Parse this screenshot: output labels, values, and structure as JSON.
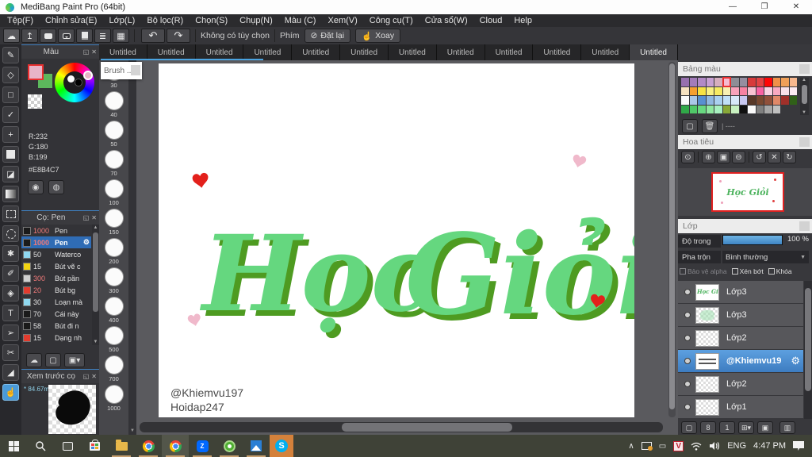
{
  "window": {
    "title": "MediBang Paint Pro (64bit)"
  },
  "menu": {
    "items": [
      "Tệp(F)",
      "Chỉnh sửa(E)",
      "Lớp(L)",
      "Bộ lọc(R)",
      "Chọn(S)",
      "Chụp(N)",
      "Màu (C)",
      "Xem(V)",
      "Công cụ(T)",
      "Cửa sổ(W)",
      "Cloud",
      "Help"
    ]
  },
  "toolbar": {
    "no_option": "Không có tùy chọn",
    "key_label": "Phím",
    "reset_label": "Đặt lại",
    "rotate_label": "Xoay"
  },
  "tabs": {
    "labels": [
      "Untitled",
      "Untitled",
      "Untitled",
      "Untitled",
      "Untitled",
      "Untitled",
      "Untitled",
      "Untitled",
      "Untitled",
      "Untitled",
      "Untitled",
      "Untitled"
    ],
    "active_index": 11
  },
  "tools": [
    {
      "name": "brush-tool-icon",
      "glyph": "✎"
    },
    {
      "name": "eraser-tool-icon",
      "glyph": "◇"
    },
    {
      "name": "rectangle-tool-icon",
      "glyph": "□"
    },
    {
      "name": "snap-tool-icon",
      "glyph": "✓"
    },
    {
      "name": "move-tool-icon",
      "glyph": "+"
    },
    {
      "name": "fill-rect-tool-icon",
      "glyph": "fillsq"
    },
    {
      "name": "bucket-tool-icon",
      "glyph": "◪"
    },
    {
      "name": "gradient-tool-icon",
      "glyph": "grad"
    },
    {
      "name": "select-tool-icon",
      "glyph": "dashbox"
    },
    {
      "name": "lasso-tool-icon",
      "glyph": "dashcirc"
    },
    {
      "name": "magic-wand-tool-icon",
      "glyph": "✱"
    },
    {
      "name": "select-pen-tool-icon",
      "glyph": "✐"
    },
    {
      "name": "select-eraser-tool-icon",
      "glyph": "◈"
    },
    {
      "name": "text-tool-icon",
      "glyph": "T"
    },
    {
      "name": "operation-tool-icon",
      "glyph": "➢"
    },
    {
      "name": "divide-tool-icon",
      "glyph": "✂"
    },
    {
      "name": "eyedropper-tool-icon",
      "glyph": "◢"
    },
    {
      "name": "hand-tool-icon",
      "glyph": "☝",
      "selected": true
    }
  ],
  "color_panel": {
    "title": "Màu",
    "r": "R:232",
    "g": "G:180",
    "b": "B:199",
    "hex": "#E8B4C7",
    "fg_color": "#e8b4c7",
    "bg_color": "#5cb85c"
  },
  "brush_panel": {
    "title": "Cọ: Pen",
    "brushes": [
      {
        "size": "1000",
        "name": "Pen",
        "swatch": "#1a1a1a",
        "red_num": true
      },
      {
        "size": "1000",
        "name": "Pen",
        "swatch": "#1a1a1a",
        "red_num": true,
        "selected": true
      },
      {
        "size": "50",
        "name": "Waterco",
        "swatch": "#8fd8f0"
      },
      {
        "size": "15",
        "name": "Bút vẽ c",
        "swatch": "#f2d411"
      },
      {
        "size": "300",
        "name": "Bút pần",
        "swatch": "#cfcfcf",
        "red_num": true
      },
      {
        "size": "20",
        "name": "Bút bg",
        "swatch": "#e23b2e",
        "red_num": true
      },
      {
        "size": "30",
        "name": "Loạn mà",
        "swatch": "#8fd8f0"
      },
      {
        "size": "70",
        "name": "Cái này",
        "swatch": "#1a1a1a"
      },
      {
        "size": "58",
        "name": "Bút đi n",
        "swatch": "#1a1a1a"
      },
      {
        "size": "15",
        "name": "Dạng nh",
        "swatch": "#e23b2e"
      }
    ]
  },
  "preview_panel": {
    "title": "Xem trước cọ",
    "note": "* 84.67m"
  },
  "brush_sizes": {
    "tooltip": "Brush ...",
    "sizes": [
      "30",
      "40",
      "50",
      "70",
      "100",
      "150",
      "200",
      "300",
      "400",
      "500",
      "700",
      "1000"
    ]
  },
  "canvas": {
    "word1": "Học",
    "word2": "Giỏi",
    "credit1": "@Khiemvu197",
    "credit2": "Hoidap247",
    "text_fill": "#65d77f",
    "text_shade": "#4e9b21",
    "heart_red": "#e3201b",
    "heart_pink": "#f0b9cb"
  },
  "palette_panel": {
    "title": "Bảng màu",
    "empty_label": "| ----",
    "selected_cell": [
      0,
      5
    ],
    "rows": [
      [
        "#9770ae",
        "#a37cba",
        "#b28ac6",
        "#c7a0d2",
        "#d6aebe",
        "#f6bad0",
        "#8e8e96",
        "#968ea0",
        "#d83a3a",
        "#e24242",
        "#fe0606",
        "#f09048",
        "#f0a058",
        "#f8b88e"
      ],
      [
        "#f6e2c0",
        "#f6a030",
        "#f6e242",
        "#f8f082",
        "#f6ea62",
        "#f8f0b2",
        "#f8a2ba",
        "#f882a2",
        "#f8c2d2",
        "#f862a2",
        "#f8d2e2",
        "#f8aac2",
        "#f8e2ea",
        "#fceaf2"
      ],
      [
        "#fafafa",
        "#aac8e8",
        "#5890d0",
        "#90b8e0",
        "#aad0f0",
        "#c0e0f8",
        "#d8e8f8",
        "#c8c8f0",
        "#583828",
        "#784830",
        "#90503a",
        "#e08868",
        "#a0302a",
        "#306018"
      ],
      [
        "#30a848",
        "#50c868",
        "#68d880",
        "#90e8a0",
        "#a8f0c0",
        "#88a838",
        "#c8f0c0",
        "#101010",
        "#fafafa",
        "#808080",
        "#a8a8a8",
        "#c0c0c0",
        "",
        ""
      ]
    ]
  },
  "navigator_panel": {
    "title": "Hoa tiêu",
    "tools": [
      {
        "name": "zoom-reset-icon",
        "glyph": "⊙"
      },
      {
        "name": "sep"
      },
      {
        "name": "zoom-in-icon",
        "glyph": "⊕"
      },
      {
        "name": "fit-window-icon",
        "glyph": "▣"
      },
      {
        "name": "zoom-out-icon",
        "glyph": "⊖"
      },
      {
        "name": "sep"
      },
      {
        "name": "rotate-left-icon",
        "glyph": "↺"
      },
      {
        "name": "reset-view-icon",
        "glyph": "✕"
      },
      {
        "name": "rotate-right-icon",
        "glyph": "↻"
      }
    ]
  },
  "layers_panel": {
    "title": "Lớp",
    "opacity_label": "Độ trong",
    "opacity_value": "100 %",
    "blend_label": "Pha trộn",
    "blend_value": "Bình thường",
    "checks": [
      {
        "label": "Bảo vệ alpha",
        "dim": true
      },
      {
        "label": "Xén bớt"
      },
      {
        "label": "Khóa"
      }
    ],
    "layers": [
      {
        "name": "Lớp3",
        "thumb": "text"
      },
      {
        "name": "Lớp3",
        "thumb": "green"
      },
      {
        "name": "Lớp2",
        "thumb": "checker"
      },
      {
        "name": "@Khiemvu19",
        "thumb": "credit",
        "selected": true
      },
      {
        "name": "Lớp2",
        "thumb": "checker"
      },
      {
        "name": "Lớp1",
        "thumb": "checker"
      }
    ],
    "layer_buttons": [
      {
        "name": "new-layer-icon",
        "glyph": "▢"
      },
      {
        "name": "8bit-layer-icon",
        "glyph": "8"
      },
      {
        "name": "1bit-layer-icon",
        "glyph": "1"
      },
      {
        "name": "add-folder-icon",
        "glyph": "⊞▾"
      },
      {
        "name": "folder-icon",
        "glyph": "▣"
      },
      {
        "name": "sep"
      },
      {
        "name": "duplicate-layer-icon",
        "glyph": "▥"
      }
    ]
  },
  "taskbar": {
    "lang": "ENG",
    "time": "4:47 PM"
  }
}
